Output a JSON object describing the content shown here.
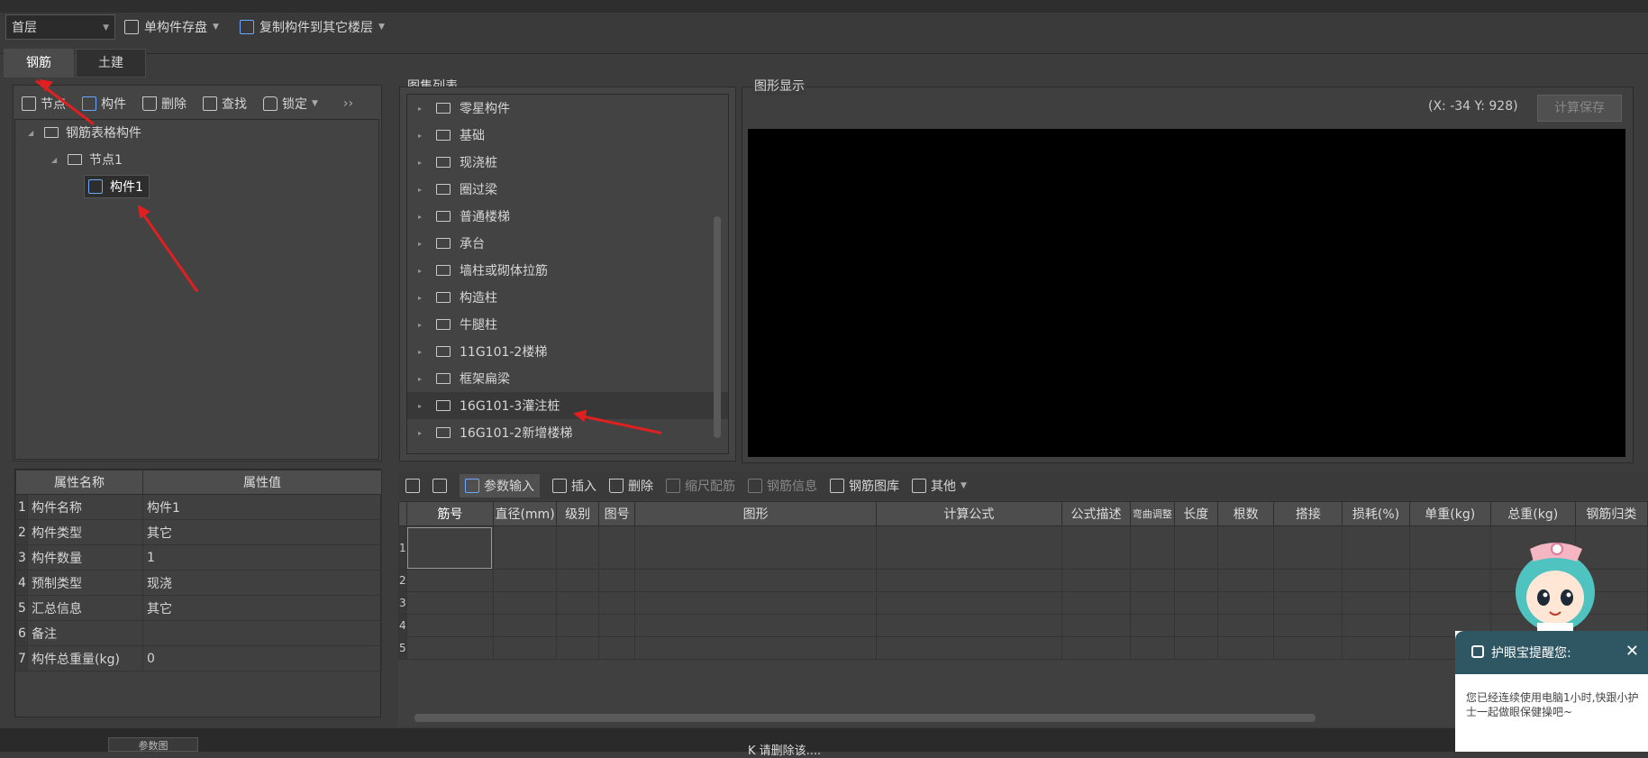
{
  "topbar": {
    "floor_select": "首层",
    "save_component": "单构件存盘",
    "copy_to_floors": "复制构件到其它楼层"
  },
  "tabs": [
    {
      "label": "钢筋",
      "active": true
    },
    {
      "label": "土建",
      "active": false
    }
  ],
  "tree_toolbar": {
    "node": "节点",
    "component": "构件",
    "delete": "删除",
    "find": "查找",
    "lock": "锁定",
    "more": "››"
  },
  "tree": {
    "root": "钢筋表格构件",
    "node": "节点1",
    "leaf": "构件1"
  },
  "properties": {
    "headers": [
      "属性名称",
      "属性值"
    ],
    "rows": [
      {
        "no": "1",
        "name": "构件名称",
        "value": "构件1"
      },
      {
        "no": "2",
        "name": "构件类型",
        "value": "其它"
      },
      {
        "no": "3",
        "name": "构件数量",
        "value": "1"
      },
      {
        "no": "4",
        "name": "预制类型",
        "value": "现浇"
      },
      {
        "no": "5",
        "name": "汇总信息",
        "value": "其它"
      },
      {
        "no": "6",
        "name": "备注",
        "value": ""
      },
      {
        "no": "7",
        "name": "构件总重量(kg)",
        "value": "0"
      }
    ]
  },
  "atlas": {
    "label": "图集列表",
    "items": [
      "零星构件",
      "基础",
      "现浇桩",
      "圈过梁",
      "普通楼梯",
      "承台",
      "墙柱或砌体拉筋",
      "构造柱",
      "牛腿柱",
      "11G101-2楼梯",
      "框架扁梁",
      "16G101-3灌注桩",
      "16G101-2新增楼梯"
    ]
  },
  "graphics": {
    "label": "图形显示",
    "coords": "(X: -34 Y: 928)",
    "calc_save": "计算保存"
  },
  "bottom_toolbar": {
    "param_input": "参数输入",
    "insert": "插入",
    "delete": "删除",
    "scale_rebar": "缩尺配筋",
    "rebar_info": "钢筋信息",
    "rebar_library": "钢筋图库",
    "other": "其他"
  },
  "rebar_table": {
    "headers": [
      "筋号",
      "直径(mm)",
      "级别",
      "图号",
      "图形",
      "计算公式",
      "公式描述",
      "弯曲调整",
      "长度",
      "根数",
      "搭接",
      "损耗(%)",
      "单重(kg)",
      "总重(kg)",
      "钢筋归类"
    ],
    "rows": [
      "1",
      "2",
      "3",
      "4",
      "5"
    ]
  },
  "bottom": {
    "tab": "参数图",
    "title": "K 请删除该...."
  },
  "toast": {
    "title": "护眼宝提醒您:",
    "close": "✕",
    "body": "您已经连续使用电脑1小时,快跟小护士一起做眼保健操吧~"
  }
}
